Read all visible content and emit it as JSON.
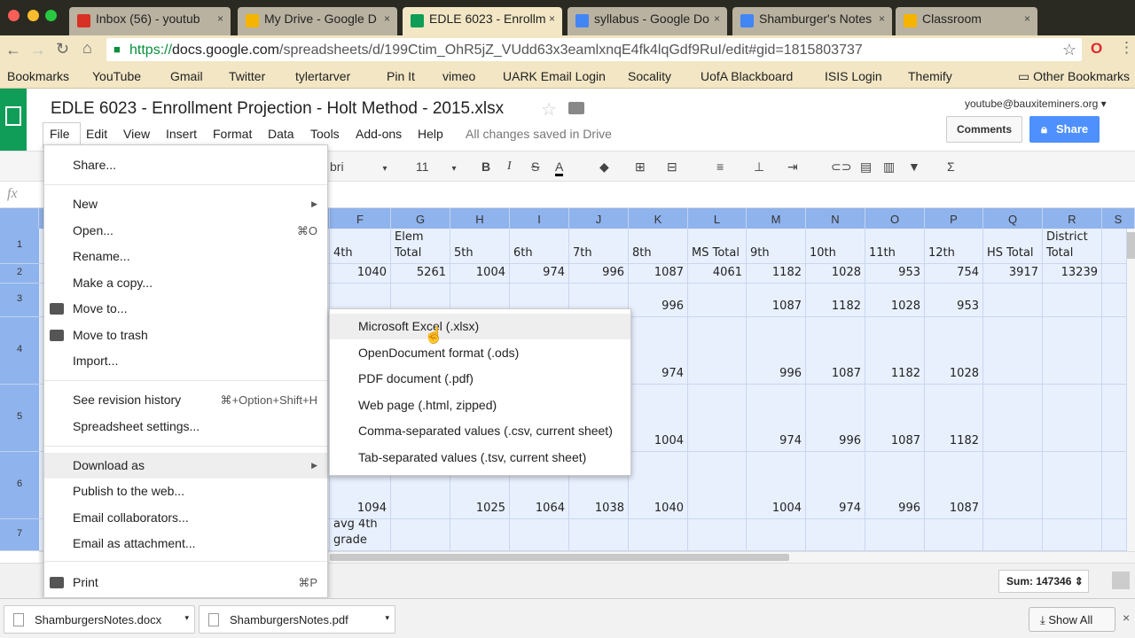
{
  "browser": {
    "tabs": [
      {
        "label": "Inbox (56) - youtub",
        "icon": "gmail-icon",
        "color": "#d93025"
      },
      {
        "label": "My Drive - Google D",
        "icon": "drive-icon",
        "color": "#f4b400"
      },
      {
        "label": "EDLE 6023 - Enrollm",
        "icon": "sheets-icon",
        "color": "#0f9d58"
      },
      {
        "label": "syllabus - Google Do",
        "icon": "docs-icon",
        "color": "#4285f4"
      },
      {
        "label": "Shamburger's Notes",
        "icon": "docs-icon",
        "color": "#4285f4"
      },
      {
        "label": "Classroom",
        "icon": "classroom-icon",
        "color": "#f4b400"
      }
    ],
    "url_scheme": "https://",
    "url_host": "docs.google.com",
    "url_path": "/spreadsheets/d/199Ctim_OhR5jZ_VUdd63x3eamlxnqE4fk4lqGdf9RuI/edit#gid=1815803737",
    "bookmarks": [
      "Bookmarks",
      "YouTube",
      "Gmail",
      "Twitter",
      "tylertarver",
      "Pin It",
      "vimeo",
      "UARK Email Login",
      "Socality",
      "UofA Blackboard",
      "ISIS Login",
      "Themify"
    ],
    "other_bookmarks": "Other Bookmarks"
  },
  "doc": {
    "title": "EDLE 6023 - Enrollment Projection - Holt Method - 2015.xlsx",
    "account": "youtube@bauxiteminers.org",
    "comments": "Comments",
    "share": "Share",
    "menus": [
      "File",
      "Edit",
      "View",
      "Insert",
      "Format",
      "Data",
      "Tools",
      "Add-ons",
      "Help"
    ],
    "save_status": "All changes saved in Drive",
    "font": "Calibri",
    "font_visible": "bri",
    "font_size": "11",
    "fx": "fx"
  },
  "grid": {
    "columns": [
      "F",
      "G",
      "H",
      "I",
      "J",
      "K",
      "L",
      "M",
      "N",
      "O",
      "P",
      "Q",
      "R",
      "S"
    ],
    "rows": [
      {
        "n": "1",
        "cells": [
          "4th",
          "Elem Total",
          "5th",
          "6th",
          "7th",
          "8th",
          "MS Total",
          "9th",
          "10th",
          "11th",
          "12th",
          "HS Total",
          "District Total"
        ]
      },
      {
        "n": "2",
        "cells": [
          "1040",
          "5261",
          "1004",
          "974",
          "996",
          "1087",
          "4061",
          "1182",
          "1028",
          "953",
          "754",
          "3917",
          "13239"
        ]
      },
      {
        "n": "3",
        "cells": [
          "",
          "",
          "",
          "",
          "",
          "996",
          "",
          "1087",
          "1182",
          "1028",
          "953",
          "",
          ""
        ]
      },
      {
        "n": "4",
        "cells": [
          "",
          "",
          "",
          "",
          "",
          "974",
          "",
          "996",
          "1087",
          "1182",
          "1028",
          "",
          ""
        ]
      },
      {
        "n": "5",
        "cells": [
          "",
          "",
          "",
          "",
          "",
          "1004",
          "",
          "974",
          "996",
          "1087",
          "1182",
          "",
          ""
        ]
      },
      {
        "n": "6",
        "cells": [
          "1094",
          "",
          "1025",
          "1064",
          "1038",
          "1040",
          "",
          "1004",
          "974",
          "996",
          "1087",
          "",
          ""
        ]
      },
      {
        "n": "7",
        "cells": [
          "avg 4th grade",
          "",
          "",
          "",
          "",
          "",
          "",
          "",
          "",
          "",
          "",
          "",
          ""
        ]
      }
    ]
  },
  "file_menu": {
    "items": [
      {
        "label": "Share..."
      },
      {
        "label": "New",
        "submenu": true
      },
      {
        "label": "Open...",
        "shortcut": "⌘O"
      },
      {
        "label": "Rename..."
      },
      {
        "label": "Make a copy..."
      },
      {
        "label": "Move to...",
        "icon": "folder-icon"
      },
      {
        "label": "Move to trash",
        "icon": "trash-icon"
      },
      {
        "label": "Import..."
      },
      {
        "label": "See revision history",
        "shortcut": "⌘+Option+Shift+H"
      },
      {
        "label": "Spreadsheet settings..."
      },
      {
        "label": "Download as",
        "submenu": true
      },
      {
        "label": "Publish to the web..."
      },
      {
        "label": "Email collaborators..."
      },
      {
        "label": "Email as attachment..."
      },
      {
        "label": "Print",
        "shortcut": "⌘P",
        "icon": "print-icon"
      }
    ]
  },
  "download_submenu": [
    "Microsoft Excel (.xlsx)",
    "OpenDocument format (.ods)",
    "PDF document (.pdf)",
    "Web page (.html, zipped)",
    "Comma-separated values (.csv, current sheet)",
    "Tab-separated values (.tsv, current sheet)"
  ],
  "status": {
    "sum": "Sum: 147346"
  },
  "downloads": {
    "files": [
      "ShamburgersNotes.docx",
      "ShamburgersNotes.pdf"
    ],
    "show_all": "Show All"
  }
}
